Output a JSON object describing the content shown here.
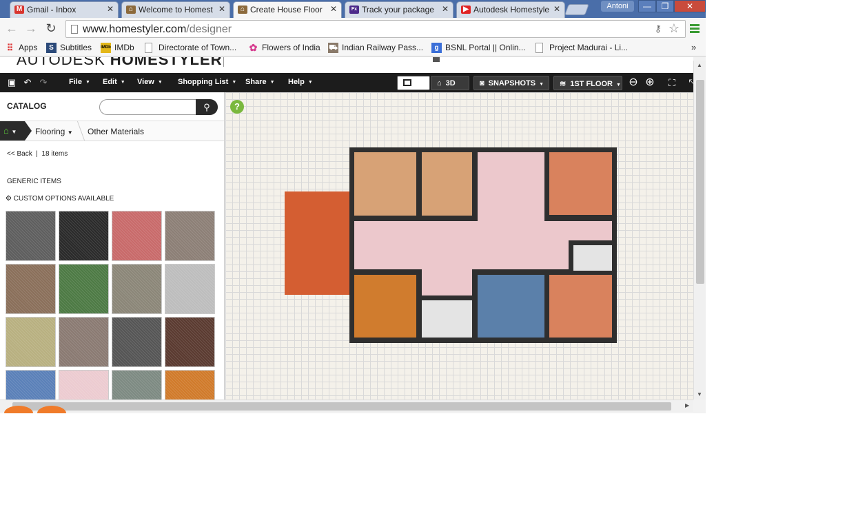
{
  "browser": {
    "tabs": [
      {
        "label": "Gmail - Inbox",
        "icon": "gmail-icon"
      },
      {
        "label": "Welcome to Homest",
        "icon": "homestyler-icon"
      },
      {
        "label": "Create House Floor",
        "icon": "homestyler-icon"
      },
      {
        "label": "Track your package",
        "icon": "fedex-icon"
      },
      {
        "label": "Autodesk Homestyle",
        "icon": "youtube-icon"
      }
    ],
    "profile": "Antoni",
    "url_domain": "www.homestyler.com",
    "url_path": "/designer",
    "bookmarks": [
      {
        "label": "Apps",
        "icon": "apps-grid-icon"
      },
      {
        "label": "Subtitles",
        "icon": "subtitles-icon"
      },
      {
        "label": "IMDb",
        "icon": "imdb-icon"
      },
      {
        "label": "Directorate of Town...",
        "icon": "page-icon"
      },
      {
        "label": "Flowers of India",
        "icon": "flower-icon"
      },
      {
        "label": "Indian Railway Pass...",
        "icon": "railway-icon"
      },
      {
        "label": "BSNL Portal || Onlin...",
        "icon": "google-icon"
      },
      {
        "label": "Project Madurai - Li...",
        "icon": "page-icon"
      }
    ],
    "bookmarks_more": "»"
  },
  "site": {
    "brand_light": "AUTODESK",
    "brand_bold": "HOMESTYLER"
  },
  "app_toolbar": {
    "menus": [
      "File",
      "Edit",
      "View",
      "Shopping List",
      "Share",
      "Help"
    ],
    "view_3d": "3D",
    "snapshots": "SNAPSHOTS",
    "floor": "1ST FLOOR"
  },
  "catalog": {
    "title": "CATALOG",
    "search_placeholder": "",
    "breadcrumb": [
      "Flooring",
      "Other Materials"
    ],
    "back_label": "<< Back",
    "item_count": "18 items",
    "section": "GENERIC ITEMS",
    "custom_options": "CUSTOM OPTIONS AVAILABLE",
    "swatch_colors": [
      "#5e5e5e",
      "#2a2a2a",
      "#c86a6a",
      "#8c7f76",
      "#8a6f5a",
      "#4d7a44",
      "#8b8678",
      "#bdbdbd",
      "#b8b080",
      "#8a7a72",
      "#555555",
      "#5a3a30",
      "#5a80b8",
      "#eccbd0",
      "#7d8a82",
      "#d07a2a"
    ]
  },
  "floorplan": {
    "wall_color": "#2f2f2f",
    "room_colors": {
      "bedroom_left": "#d7a276",
      "bedroom_mid": "#d7a276",
      "hall": "#ecc8cc",
      "bedroom_right": "#d9825d",
      "kitchen": "#d07c2e",
      "bath_small": "#e4e4e4",
      "living": "#5b80aa",
      "bedroom_br": "#d9825d",
      "bath_right": "#e4e4e4",
      "porch": "#d45e32"
    }
  }
}
